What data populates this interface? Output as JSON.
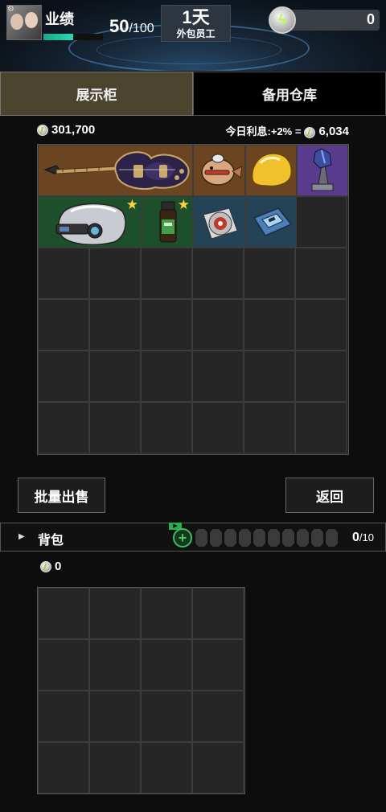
{
  "header": {
    "performance_label": "业绩",
    "performance_value": "50",
    "performance_max": "/100",
    "performance_progress": 0.5,
    "day": "1天",
    "role": "外包员工",
    "energy": "0"
  },
  "tabs": {
    "display": "展示柜",
    "storage": "备用仓库"
  },
  "cabinet": {
    "money": "301,700",
    "interest_label": "今日利息:+2% =",
    "interest_amount": "6,034"
  },
  "items": [
    {
      "name": "electric-guitar",
      "rarity": "brown"
    },
    {
      "name": "toy-fish",
      "rarity": "brown"
    },
    {
      "name": "gold-nugget",
      "rarity": "brown"
    },
    {
      "name": "crystal-trophy",
      "rarity": "purple"
    },
    {
      "name": "vr-helmet",
      "rarity": "green",
      "starred": true
    },
    {
      "name": "medicine-bottle",
      "rarity": "green",
      "starred": true
    },
    {
      "name": "cd-disc",
      "rarity": "blue"
    },
    {
      "name": "memory-card",
      "rarity": "blue"
    }
  ],
  "buttons": {
    "bulk_sell": "批量出售",
    "back": "返回"
  },
  "backpack": {
    "label": "背包",
    "count": "0",
    "max": "/10",
    "money": "0"
  }
}
